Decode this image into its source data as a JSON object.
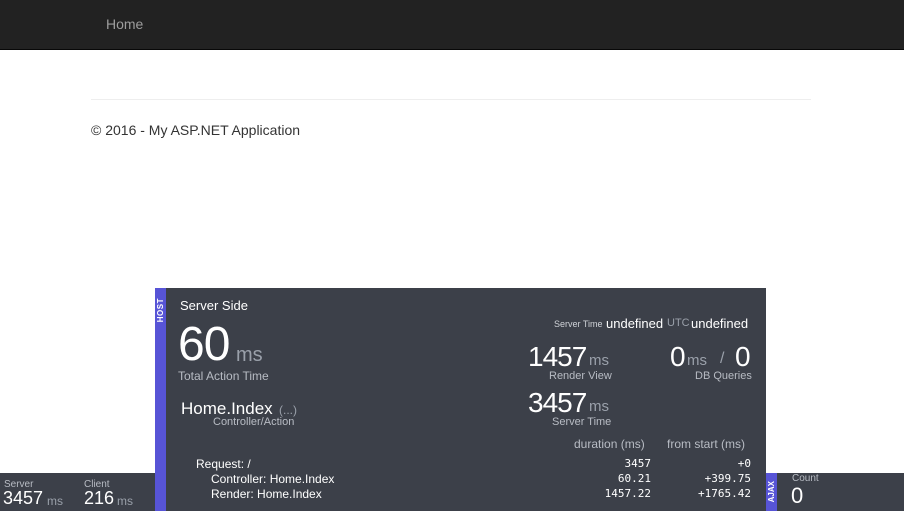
{
  "nav": {
    "home_label": "Home"
  },
  "footer": {
    "copyright": "© 2016 - My ASP.NET Application"
  },
  "profiler": {
    "host_label": "HOST",
    "title": "Server Side",
    "total_action_time": {
      "value": "60",
      "unit": "ms",
      "label": "Total Action Time"
    },
    "controller_action": {
      "value": "Home.Index",
      "more": "(...)",
      "label": "Controller/Action"
    },
    "server_time_header": {
      "label": "Server Time",
      "value1": "undefined",
      "utc": "UTC",
      "value2": "undefined"
    },
    "render_view": {
      "value": "1457",
      "unit": "ms",
      "label": "Render View"
    },
    "db_queries": {
      "value1": "0",
      "unit": "ms",
      "slash": "/",
      "value2": "0",
      "label": "DB Queries"
    },
    "server_time": {
      "value": "3457",
      "unit": "ms",
      "label": "Server Time"
    },
    "table": {
      "col_duration": "duration (ms)",
      "col_from_start": "from start (ms)",
      "rows": [
        {
          "name": "Request: /",
          "duration": "3457",
          "from_start": "+0"
        },
        {
          "name": "Controller: Home.Index",
          "duration": "60.21",
          "from_start": "+399.75"
        },
        {
          "name": "Render: Home.Index",
          "duration": "1457.22",
          "from_start": "+1765.42"
        }
      ]
    }
  },
  "bottom_bar": {
    "server": {
      "label": "Server",
      "value": "3457",
      "unit": "ms"
    },
    "client": {
      "label": "Client",
      "value": "216",
      "unit": "ms"
    },
    "ajax_label": "AJAX",
    "count": {
      "label": "Count",
      "value": "0"
    }
  },
  "colors": {
    "navbar": "#222222",
    "panel": "#3c4049",
    "accent": "#5754d6"
  }
}
